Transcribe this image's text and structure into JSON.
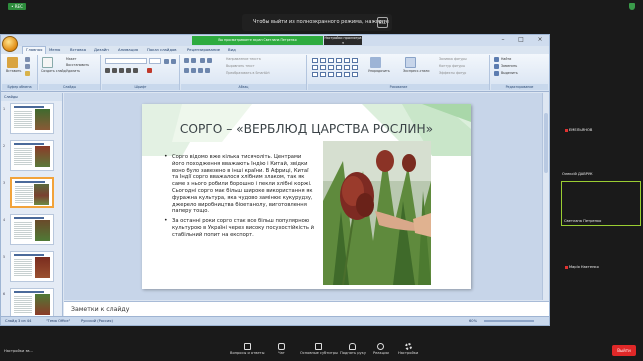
{
  "zoom": {
    "top_badge": "• REC",
    "fullscreen_notice": "Чтобы выйти из полноэкранного режима, нажмите",
    "esc_key": "Esc",
    "banner_viewing": "Вы просматриваете экран Светлана Петренко",
    "banner_dropdown": "▾",
    "banner_settings": "Настройки просмотра",
    "participants": [
      {
        "name": "ЕМЕЛЬЯНОВ",
        "muted": true
      },
      {
        "name": "Олексій ДАВРУК",
        "muted": false
      },
      {
        "name": "Светлана Петренко",
        "muted": false
      },
      {
        "name": "Марія Наєтенко",
        "muted": true
      }
    ],
    "bottom_left_label": "Настройки зв...",
    "toolbar": [
      {
        "label": "Вопросы и ответы",
        "icon": "qa-icon"
      },
      {
        "label": "Чат",
        "icon": "chat-icon"
      },
      {
        "label": "Основные субтитры",
        "icon": "cc-icon"
      },
      {
        "label": "Поднять руку",
        "icon": "raise-hand-icon"
      },
      {
        "label": "Реакции",
        "icon": "reactions-icon"
      },
      {
        "label": "Настройки",
        "icon": "gear-icon"
      }
    ],
    "leave_button": "Выйти"
  },
  "powerpoint": {
    "tabs": [
      "Главная",
      "Меню",
      "Вставка",
      "Дизайн",
      "Анимация",
      "Показ слайдов",
      "Рецензирование",
      "Вид"
    ],
    "active_tab": "Главная",
    "ribbon_groups": [
      {
        "label": "Буфер обмена",
        "items": [
          "Вставить",
          "Вырезать",
          "Копировать",
          "Формат по образцу"
        ]
      },
      {
        "label": "Слайды",
        "items": [
          "Создать слайд",
          "Макет",
          "Восстановить",
          "Удалить"
        ]
      },
      {
        "label": "Шрифт",
        "items": []
      },
      {
        "label": "Абзац",
        "items": [
          "Направление текста",
          "Выровнять текст",
          "Преобразовать в SmartArt"
        ]
      },
      {
        "label": "Рисование",
        "items": [
          "Упорядочить",
          "Экспресс-стили",
          "Заливка фигуры",
          "Контур фигуры",
          "Эффекты фигур"
        ]
      },
      {
        "label": "Редактирование",
        "items": [
          "Найти",
          "Заменить",
          "Выделить"
        ]
      }
    ],
    "thumbnail_tabs": [
      "Слайды",
      "Структура"
    ],
    "slide_numbers": [
      "1",
      "2",
      "3",
      "4",
      "5",
      "6"
    ],
    "slide": {
      "title": "СОРГО – «ВЕРБЛЮД ЦАРСТВА РОСЛИН»",
      "bullets": [
        "Сорго відомо вже кілька тисячоліть. Центрами його походження вважають Індію і Китай, звідки воно було завезено в інші країни. В Африці, Китаї та Індії сорго вважалося хлібним злаком, так як саме з нього робили борошно і пекли хлібні коржі. Сьогодні сорго має більш широке використання як фуражна культура, яка чудово замінює кукурудзу, джерело виробництва біоетанолу, виготовлення паперу тощо.",
        "За останні роки сорго стає все більш популярною культурою в Україні через високу посухостійкість й стабільний попит на експорт."
      ]
    },
    "notes_placeholder": "Заметки к слайду",
    "status": {
      "slide_info": "Слайд 3 из 44",
      "theme": "\"Тема Office\"",
      "language": "Русский (Россия)",
      "zoom": "60%"
    }
  }
}
